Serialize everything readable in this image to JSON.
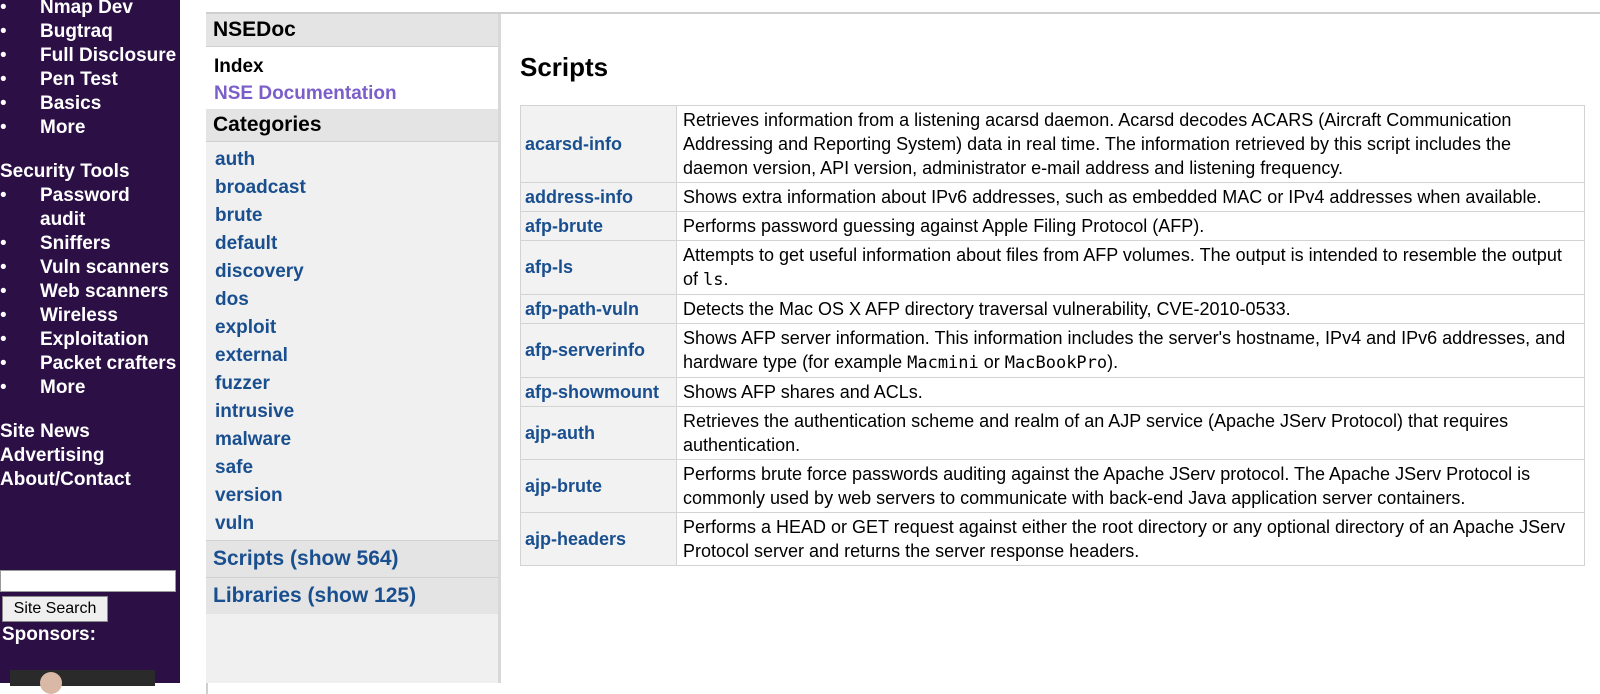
{
  "left_nav": {
    "items": [
      {
        "type": "link",
        "label": "Nmap Dev"
      },
      {
        "type": "link",
        "label": "Bugtraq"
      },
      {
        "type": "link",
        "label": "Full Disclosure"
      },
      {
        "type": "link",
        "label": "Pen Test"
      },
      {
        "type": "link",
        "label": "Basics"
      },
      {
        "type": "link",
        "label": "More"
      },
      {
        "type": "section",
        "label": "Security Tools"
      },
      {
        "type": "link",
        "label": "Password audit"
      },
      {
        "type": "link",
        "label": "Sniffers"
      },
      {
        "type": "link",
        "label": "Vuln scanners"
      },
      {
        "type": "link",
        "label": "Web scanners"
      },
      {
        "type": "link",
        "label": "Wireless"
      },
      {
        "type": "link",
        "label": "Exploitation"
      },
      {
        "type": "link",
        "label": "Packet crafters"
      },
      {
        "type": "link",
        "label": "More"
      },
      {
        "type": "section",
        "label": "Site News"
      },
      {
        "type": "section",
        "label": "Advertising"
      },
      {
        "type": "section",
        "label": "About/Contact"
      }
    ],
    "bullet": "•",
    "search_button": "Site Search",
    "sponsors_label": "Sponsors:"
  },
  "sidebar": {
    "title": "NSEDoc",
    "index_label": "Index",
    "nse_doc_link": "NSE Documentation",
    "categories_title": "Categories",
    "categories": [
      "auth",
      "broadcast",
      "brute",
      "default",
      "discovery",
      "dos",
      "exploit",
      "external",
      "fuzzer",
      "intrusive",
      "malware",
      "safe",
      "version",
      "vuln"
    ],
    "scripts_link": "Scripts (show 564)",
    "libraries_link": "Libraries (show 125)"
  },
  "main": {
    "title": "Scripts",
    "scripts": [
      {
        "name": "acarsd-info",
        "desc": [
          {
            "t": "Retrieves information from a listening acarsd daemon. Acarsd decodes ACARS (Aircraft Communication Addressing and Reporting System) data in real time. The information retrieved by this script includes the daemon version, API version, administrator e-mail address and listening frequency."
          }
        ]
      },
      {
        "name": "address-info",
        "desc": [
          {
            "t": "Shows extra information about IPv6 addresses, such as embedded MAC or IPv4 addresses when available."
          }
        ]
      },
      {
        "name": "afp-brute",
        "desc": [
          {
            "t": "Performs password guessing against Apple Filing Protocol (AFP)."
          }
        ]
      },
      {
        "name": "afp-ls",
        "desc": [
          {
            "t": "Attempts to get useful information about files from AFP volumes. The output is intended to resemble the output of "
          },
          {
            "t": "ls",
            "code": true
          },
          {
            "t": "."
          }
        ]
      },
      {
        "name": "afp-path-vuln",
        "desc": [
          {
            "t": "Detects the Mac OS X AFP directory traversal vulnerability, CVE-2010-0533."
          }
        ]
      },
      {
        "name": "afp-serverinfo",
        "desc": [
          {
            "t": "Shows AFP server information. This information includes the server's hostname, IPv4 and IPv6 addresses, and hardware type (for example "
          },
          {
            "t": "Macmini",
            "code": true
          },
          {
            "t": " or "
          },
          {
            "t": "MacBookPro",
            "code": true
          },
          {
            "t": ")."
          }
        ]
      },
      {
        "name": "afp-showmount",
        "desc": [
          {
            "t": "Shows AFP shares and ACLs."
          }
        ]
      },
      {
        "name": "ajp-auth",
        "desc": [
          {
            "t": "Retrieves the authentication scheme and realm of an AJP service (Apache JServ Protocol) that requires authentication."
          }
        ]
      },
      {
        "name": "ajp-brute",
        "desc": [
          {
            "t": "Performs brute force passwords auditing against the Apache JServ protocol. The Apache JServ Protocol is commonly used by web servers to communicate with back-end Java application server containers."
          }
        ]
      },
      {
        "name": "ajp-headers",
        "desc": [
          {
            "t": "Performs a HEAD or GET request against either the root directory or any optional directory of an Apache JServ Protocol server and returns the server response headers."
          }
        ]
      }
    ]
  }
}
